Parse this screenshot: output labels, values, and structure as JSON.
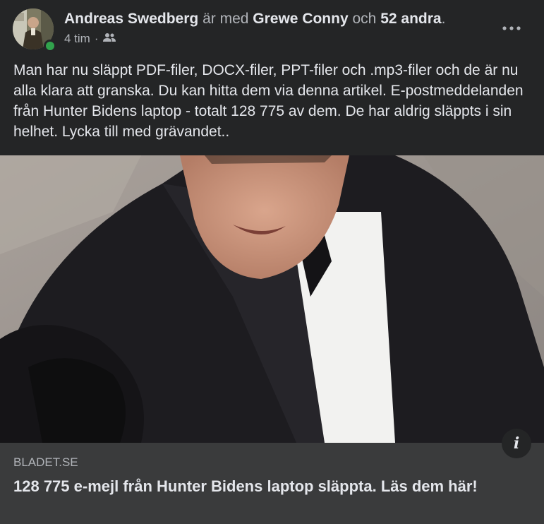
{
  "header": {
    "author": "Andreas Swedberg",
    "with_text": "är med",
    "tagged_person": "Grewe Conny",
    "and_text": "och",
    "others": "52 andra",
    "period": ".",
    "time": "4 tim",
    "separator": "·",
    "audience_icon": "friends-icon",
    "more_icon": "more-options-icon",
    "online_status_color": "#31a24c"
  },
  "post": {
    "text": "Man har nu släppt PDF-filer, DOCX-filer, PPT-filer och .mp3-filer och de är nu alla klara att granska. Du kan hitta dem via denna artikel. E-postmeddelanden från Hunter Bidens laptop - totalt 128 775 av dem. De har aldrig släppts i sin helhet. Lycka till med grävandet.."
  },
  "link": {
    "domain": "BLADET.SE",
    "title": "128 775 e-mejl från Hunter Bidens laptop släppta. Läs dem här!",
    "info_label": "i"
  },
  "colors": {
    "background": "#242526",
    "footer_background": "#3a3b3c",
    "primary_text": "#e4e6eb",
    "secondary_text": "#b0b3b8"
  }
}
